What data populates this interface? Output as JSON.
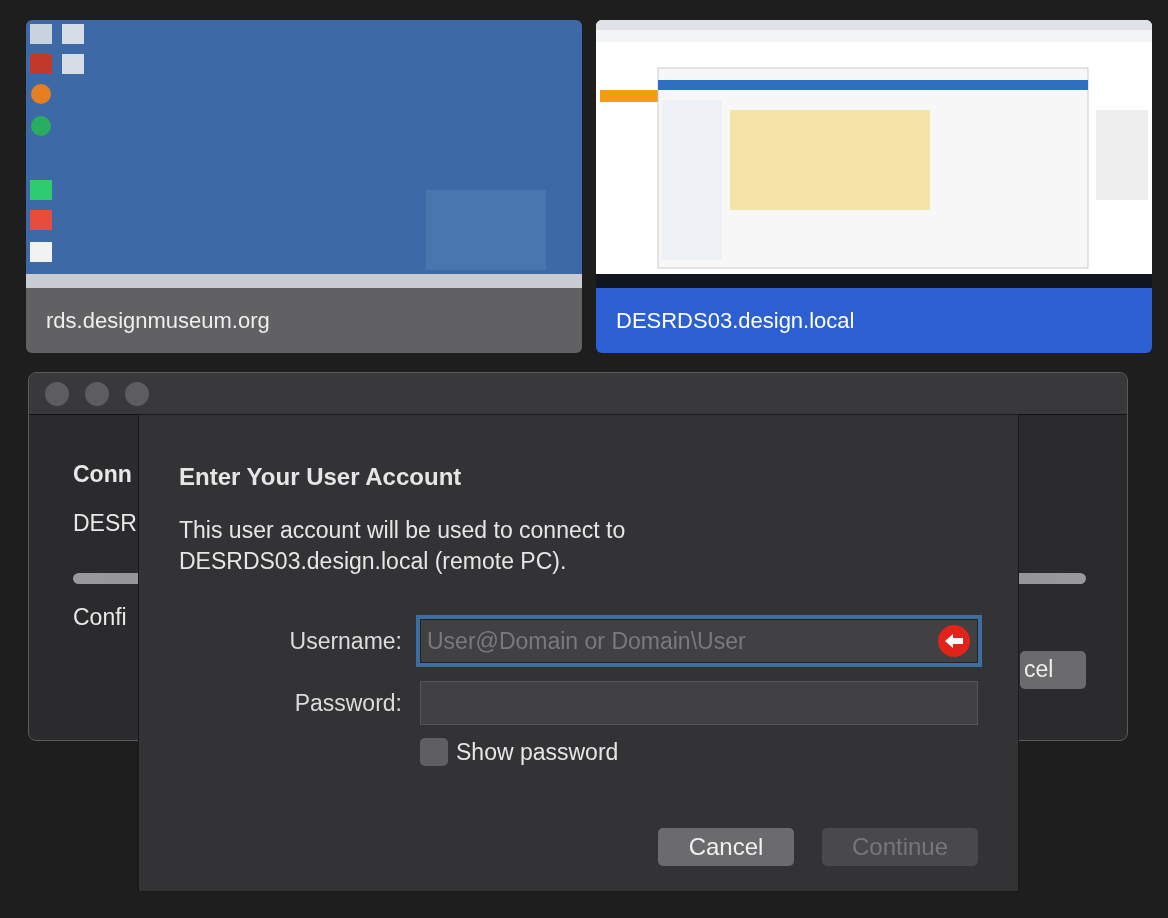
{
  "sessions": [
    {
      "label": "rds.designmuseum.org",
      "selected": false
    },
    {
      "label": "DESRDS03.design.local",
      "selected": true
    }
  ],
  "window": {
    "heading": "Conn",
    "subtitle": "DESR",
    "progress": {
      "level": 1
    },
    "status": "Confi",
    "button": "cel"
  },
  "sheet": {
    "title": "Enter Your User Account",
    "message": "This user account will be used to connect to DESRDS03.design.local (remote PC).",
    "fields": [
      {
        "label": "Username:",
        "placeholder": "User@Domain or Domain\\User",
        "focused": true
      },
      {
        "label": "Password:",
        "focused": false
      }
    ],
    "show_password": {
      "label": "Show password",
      "checked": false
    },
    "buttons": [
      {
        "label": "Cancel",
        "disabled": false
      },
      {
        "label": "Continue",
        "disabled": true
      }
    ]
  }
}
